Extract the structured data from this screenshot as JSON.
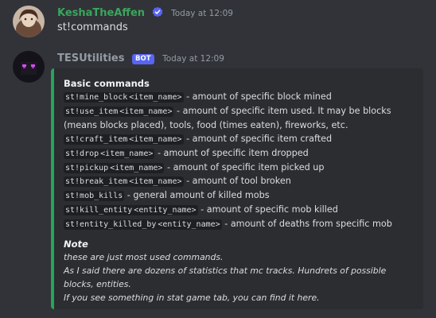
{
  "messages": [
    {
      "username": "KeshaTheAffen",
      "username_color": "#3ba55d",
      "verified_icon": "verified-badge-icon",
      "timestamp": "Today at 12:09",
      "text": "st!commands"
    },
    {
      "username": "TESUtilities",
      "username_color": "#949ba4",
      "bot_tag": "BOT",
      "timestamp": "Today at 12:09",
      "embed": {
        "accent_color": "#23a55a",
        "field_title": "Basic commands",
        "commands": [
          {
            "code": "st!mine_block",
            "arg": "<item_name>",
            "desc": " - amount of specific block mined"
          },
          {
            "code": "st!use_item",
            "arg": "<item_name>",
            "desc": " - amount of specific item used. It may be blocks (means blocks placed), tools, food (times eaten), fireworks, etc."
          },
          {
            "code": "st!craft_item",
            "arg": "<item_name>",
            "desc": " - amount of specific item crafted"
          },
          {
            "code": "st!drop",
            "arg": "<item_name>",
            "desc": " - amount of specific item dropped"
          },
          {
            "code": "st!pickup",
            "arg": "<item_name>",
            "desc": " - amount of specific item picked up"
          },
          {
            "code": "st!break_item",
            "arg": "<item_name>",
            "desc": " - amount of tool broken"
          },
          {
            "code": "st!mob_kills",
            "arg": "",
            "desc": " - general amount of killed mobs"
          },
          {
            "code": "st!kill_entity",
            "arg": "<entity_name>",
            "desc": " - amount of specific mob killed"
          },
          {
            "code": "st!entity_killed_by",
            "arg": "<entity_name>",
            "desc": " - amount of deaths from specific mob"
          }
        ],
        "note_title": "Note",
        "note_lines": [
          "these are just most used commands.",
          "As I said there are dozens of statistics that mc tracks. Hundrets of possible blocks, entities.",
          "If you see something in stat game tab, you can find it here."
        ]
      }
    }
  ]
}
